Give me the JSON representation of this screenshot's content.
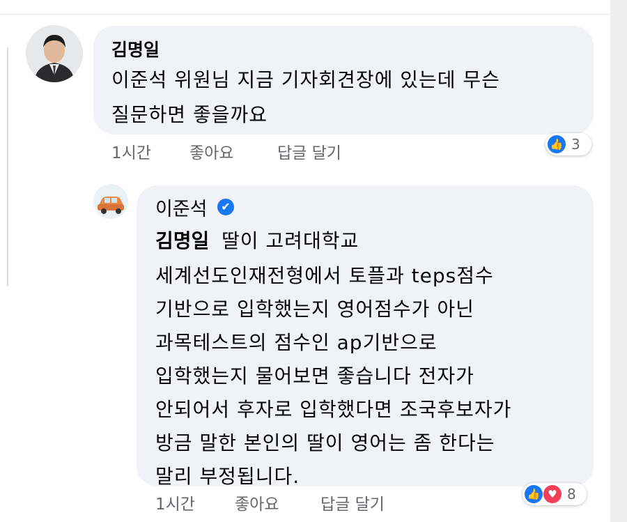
{
  "comment1": {
    "author": "김명일",
    "lines": [
      "이준석 위원님 지금 기자회견장에 있는데 무슨",
      "질문하면 좋을까요"
    ],
    "time": "1시간",
    "like_label": "좋아요",
    "reply_label": "답글 달기",
    "reaction_count": "3"
  },
  "comment2": {
    "author": "이준석",
    "mention": "김명일",
    "first_line_rest": "딸이 고려대학교",
    "lines": [
      "세계선도인재전형에서 토플과 teps점수",
      "기반으로 입학했는지 영어점수가 아닌",
      "과목테스트의 점수인 ap기반으로",
      "입학했는지 물어보면 좋습니다  전자가",
      "안되어서 후자로 입학했다면 조국후보자가",
      "방금 말한 본인의 딸이 영어는 좀 한다는",
      "말리 부정됩니다."
    ],
    "time": "1시간",
    "like_label": "좋아요",
    "reply_label": "답글 달기",
    "reaction_count": "8"
  },
  "icons": {
    "verified": "✔",
    "like": "👍",
    "love": "♥"
  },
  "colors": {
    "bubble": "#f0f2f5",
    "like_blue": "#1877f2",
    "love_red": "#f33e58",
    "meta_gray": "#65676b"
  }
}
